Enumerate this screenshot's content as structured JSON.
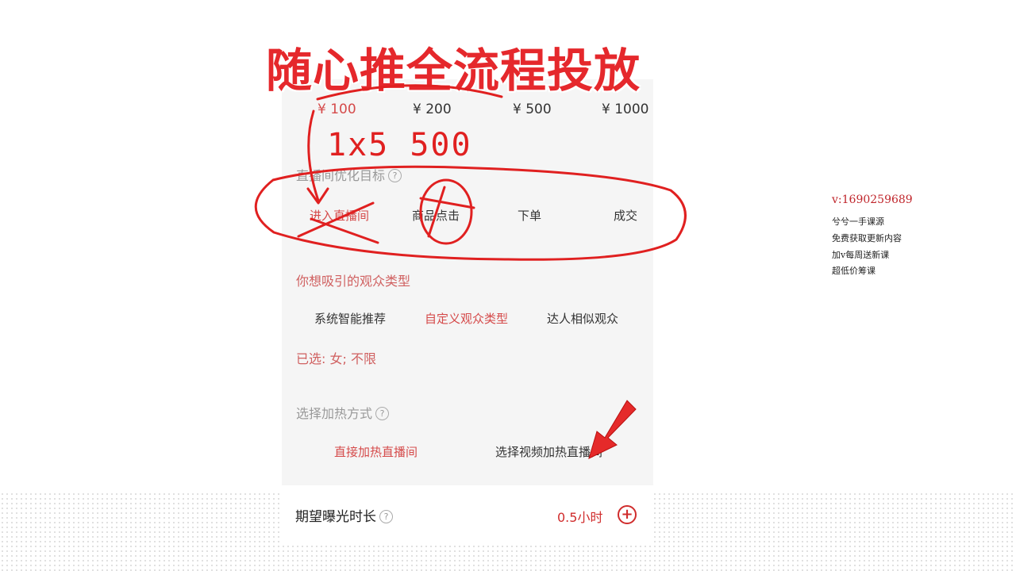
{
  "banner": "随心推全流程投放",
  "prices": [
    "¥ 100",
    "¥ 200",
    "¥ 500",
    "¥ 1000"
  ],
  "handwriting": "1x5 500",
  "optimize": {
    "label": "直播间优化目标",
    "help": "?",
    "options": [
      "进入直播间",
      "商品点击",
      "下单",
      "成交"
    ]
  },
  "audience": {
    "label": "你想吸引的观众类型",
    "options": [
      "系统智能推荐",
      "自定义观众类型",
      "达人相似观众"
    ],
    "selected": "已选: 女; 不限"
  },
  "heat": {
    "label": "选择加热方式",
    "help": "?",
    "options": [
      "直接加热直播间",
      "选择视频加热直播间"
    ]
  },
  "duration": {
    "label": "期望曝光时长",
    "help": "?",
    "value": "0.5小时",
    "plus": "+"
  },
  "side": {
    "contact": "v:1690259689",
    "lines": [
      "兮兮一手课源",
      "免费获取更新内容",
      "加v每周送新课",
      "超低价筹课"
    ]
  },
  "colors": {
    "accent": "#d54a4a",
    "ink": "#e02020",
    "banner": "#e5282c"
  }
}
